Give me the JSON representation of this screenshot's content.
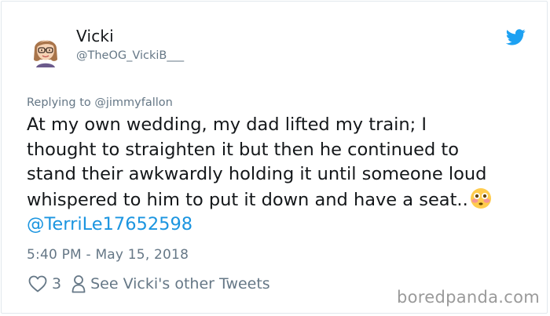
{
  "user": {
    "display_name": "Vicki",
    "handle": "@TheOG_VickiB___"
  },
  "reply": {
    "prefix": "Replying to",
    "mention": "@jimmyfallon"
  },
  "tweet": {
    "lines": [
      "At my own wedding, my dad lifted my train; I",
      "thought to straighten it but then he continued to",
      "stand their awkwardly holding it until someone loud",
      "whispered to him to put it down and have a seat.."
    ],
    "mention": "@TerriLe17652598",
    "timestamp": "5:40 PM - May 15, 2018"
  },
  "actions": {
    "like_count": "3",
    "other_tweets_label": "See Vicki's other Tweets"
  },
  "watermark": "boredpanda.com",
  "icons": {
    "logo": "twitter-bird-icon",
    "like": "heart-icon",
    "profile": "person-icon",
    "emoji": "flushed-face-emoji"
  },
  "colors": {
    "brand": "#1da1f2",
    "link": "#1b95e0",
    "muted": "#657786",
    "text": "#14171a"
  }
}
